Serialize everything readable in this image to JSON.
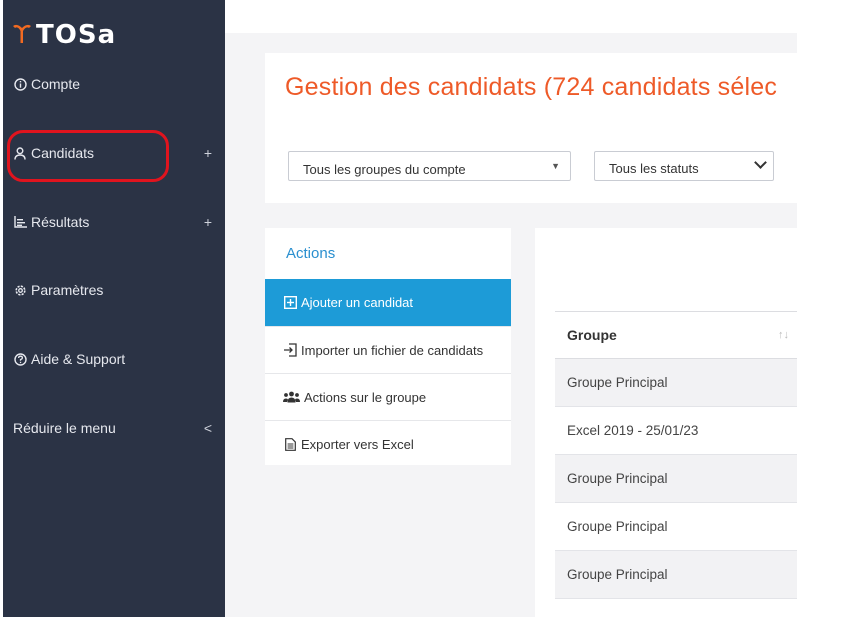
{
  "brand": {
    "mark": "т",
    "name": "TOSa"
  },
  "sidebar": {
    "items": [
      {
        "label": "Compte",
        "icon": "info-icon",
        "expandable": false
      },
      {
        "label": "Candidats",
        "icon": "user-icon",
        "expandable": true,
        "expand_symbol": "+"
      },
      {
        "label": "Résultats",
        "icon": "chart-icon",
        "expandable": true,
        "expand_symbol": "+"
      },
      {
        "label": "Paramètres",
        "icon": "gear-icon",
        "expandable": false
      },
      {
        "label": "Aide & Support",
        "icon": "help-icon",
        "expandable": false
      },
      {
        "label": "Réduire le menu",
        "icon": "",
        "expandable": false,
        "collapse_symbol": "<"
      }
    ],
    "highlight_color": "#e0141e"
  },
  "header": {
    "title": "Gestion des candidats (724 candidats sélec",
    "group_select": {
      "value": "Tous les groupes du compte"
    },
    "status_select": {
      "value": "Tous les statuts"
    }
  },
  "actions": {
    "title": "Actions",
    "items": [
      {
        "label": "Ajouter un candidat",
        "icon": "plus-square-icon",
        "active": true
      },
      {
        "label": "Importer un fichier de candidats",
        "icon": "import-icon",
        "active": false
      },
      {
        "label": "Actions sur le groupe",
        "icon": "users-icon",
        "active": false
      },
      {
        "label": "Exporter vers Excel",
        "icon": "file-icon",
        "active": false
      }
    ]
  },
  "table": {
    "header": "Groupe",
    "sort_symbol": "↑↓",
    "rows": [
      "Groupe Principal",
      "Excel 2019 - 25/01/23",
      "Groupe Principal",
      "Groupe Principal",
      "Groupe Principal"
    ]
  },
  "colors": {
    "sidebar_bg": "#2b3345",
    "accent_orange": "#ee5a28",
    "accent_blue": "#1d9bd7"
  }
}
